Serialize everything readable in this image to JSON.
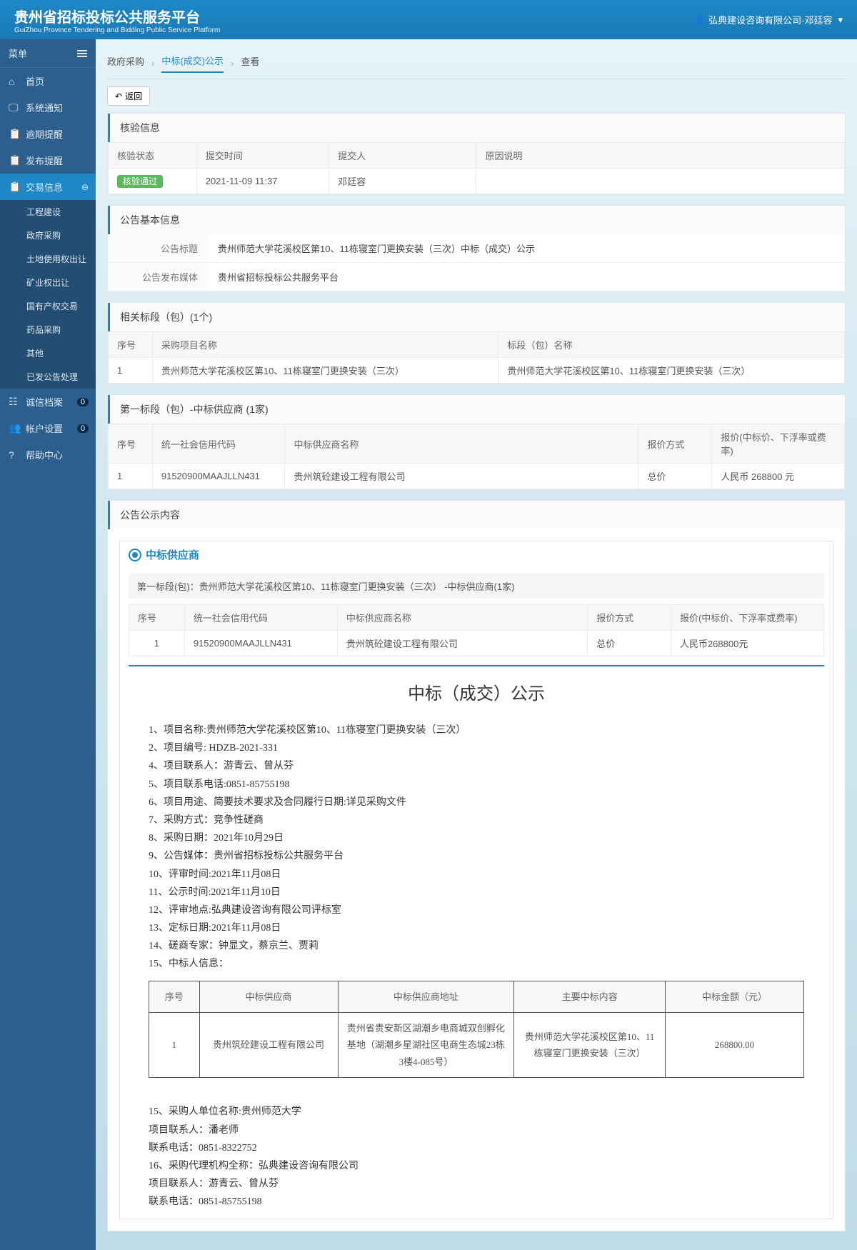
{
  "header": {
    "title": "贵州省招标投标公共服务平台",
    "subtitle": "GuiZhou Province Tendering and Bidding Public Service Platform",
    "user": "弘典建设咨询有限公司-邓廷容"
  },
  "menu": {
    "label": "菜单",
    "items": [
      {
        "icon": "⌂",
        "label": "首页"
      },
      {
        "icon": "🖵",
        "label": "系统通知"
      },
      {
        "icon": "📋",
        "label": "逾期提醒"
      },
      {
        "icon": "📋",
        "label": "发布提醒"
      },
      {
        "icon": "📋",
        "label": "交易信息",
        "active": true,
        "expand": true
      }
    ],
    "submenu": [
      "工程建设",
      "政府采购",
      "土地使用权出让",
      "矿业权出让",
      "国有产权交易",
      "药品采购",
      "其他",
      "已发公告处理"
    ],
    "items2": [
      {
        "icon": "☷",
        "label": "诚信档案",
        "badge": "0"
      },
      {
        "icon": "👥",
        "label": "帐户设置",
        "badge": "0"
      },
      {
        "icon": "?",
        "label": "帮助中心"
      }
    ]
  },
  "breadcrumb": [
    "政府采购",
    "中标(成交)公示",
    "查看"
  ],
  "back": "返回",
  "panel1": {
    "title": "核验信息",
    "headers": [
      "核验状态",
      "提交时间",
      "提交人",
      "原因说明"
    ],
    "row": {
      "status": "核验通过",
      "time": "2021-11-09 11:37",
      "submitter": "邓廷容",
      "reason": ""
    }
  },
  "panel2": {
    "title": "公告基本信息",
    "rows": [
      {
        "label": "公告标题",
        "value": "贵州师范大学花溪校区第10、11栋寝室门更换安装（三次）中标（成交）公示"
      },
      {
        "label": "公告发布媒体",
        "value": "贵州省招标投标公共服务平台"
      }
    ]
  },
  "panel3": {
    "title": "相关标段（包）(1个)",
    "headers": [
      "序号",
      "采购项目名称",
      "标段（包）名称"
    ],
    "row": [
      "1",
      "贵州师范大学花溪校区第10、11栋寝室门更换安装（三次）",
      "贵州师范大学花溪校区第10、11栋寝室门更换安装（三次）"
    ]
  },
  "panel4": {
    "title": "第一标段（包）-中标供应商 (1家)",
    "headers": [
      "序号",
      "统一社会信用代码",
      "中标供应商名称",
      "报价方式",
      "报价(中标价、下浮率或费率)"
    ],
    "row": [
      "1",
      "91520900MAAJLLN431",
      "贵州筑砼建设工程有限公司",
      "总价",
      "人民币 268800 元"
    ]
  },
  "panel5": {
    "title": "公告公示内容",
    "supplier_title": "中标供应商",
    "sub_header": "第一标段(包)：贵州师范大学花溪校区第10、11栋寝室门更换安装（三次）  -中标供应商(1家)",
    "table_headers": [
      "序号",
      "统一社会信用代码",
      "中标供应商名称",
      "报价方式",
      "报价(中标价、下浮率或费率)"
    ],
    "table_row": [
      "1",
      "91520900MAAJLLN431",
      "贵州筑砼建设工程有限公司",
      "总价",
      "人民币268800元"
    ],
    "content_title": "中标（成交）公示",
    "lines": [
      "1、项目名称:贵州师范大学花溪校区第10、11栋寝室门更换安装（三次）",
      "2、项目编号: HDZB-2021-331",
      "4、项目联系人：游青云、曾从芬",
      "5、项目联系电话:0851-85755198",
      "6、项目用途、简要技术要求及合同履行日期:详见采购文件",
      "7、采购方式：竞争性磋商",
      "8、采购日期：2021年10月29日",
      "9、公告媒体：贵州省招标投标公共服务平台",
      "10、评审时间:2021年11月08日",
      "11、公示时间:2021年11月10日",
      "12、评审地点:弘典建设咨询有限公司评标室",
      "13、定标日期:2021年11月08日",
      "14、磋商专家：钟显文，蔡京兰、贾莉",
      "15、中标人信息："
    ],
    "winner_table": {
      "headers": [
        "序号",
        "中标供应商",
        "中标供应商地址",
        "主要中标内容",
        "中标金额（元）"
      ],
      "row": [
        "1",
        "贵州筑砼建设工程有限公司",
        "贵州省贵安新区湖潮乡电商城双创孵化基地（湖潮乡星湖社区电商生态城23栋3楼4-085号）",
        "贵州师范大学花溪校区第10、11栋寝室门更换安装（三次）",
        "268800.00"
      ]
    },
    "lines2": [
      "15、采购人单位名称:贵州师范大学",
      "项目联系人：潘老师",
      "联系电话：0851-8322752",
      "16、采购代理机构全称：弘典建设咨询有限公司",
      "项目联系人：游青云、曾从芬",
      "联系电话：0851-85755198"
    ]
  }
}
